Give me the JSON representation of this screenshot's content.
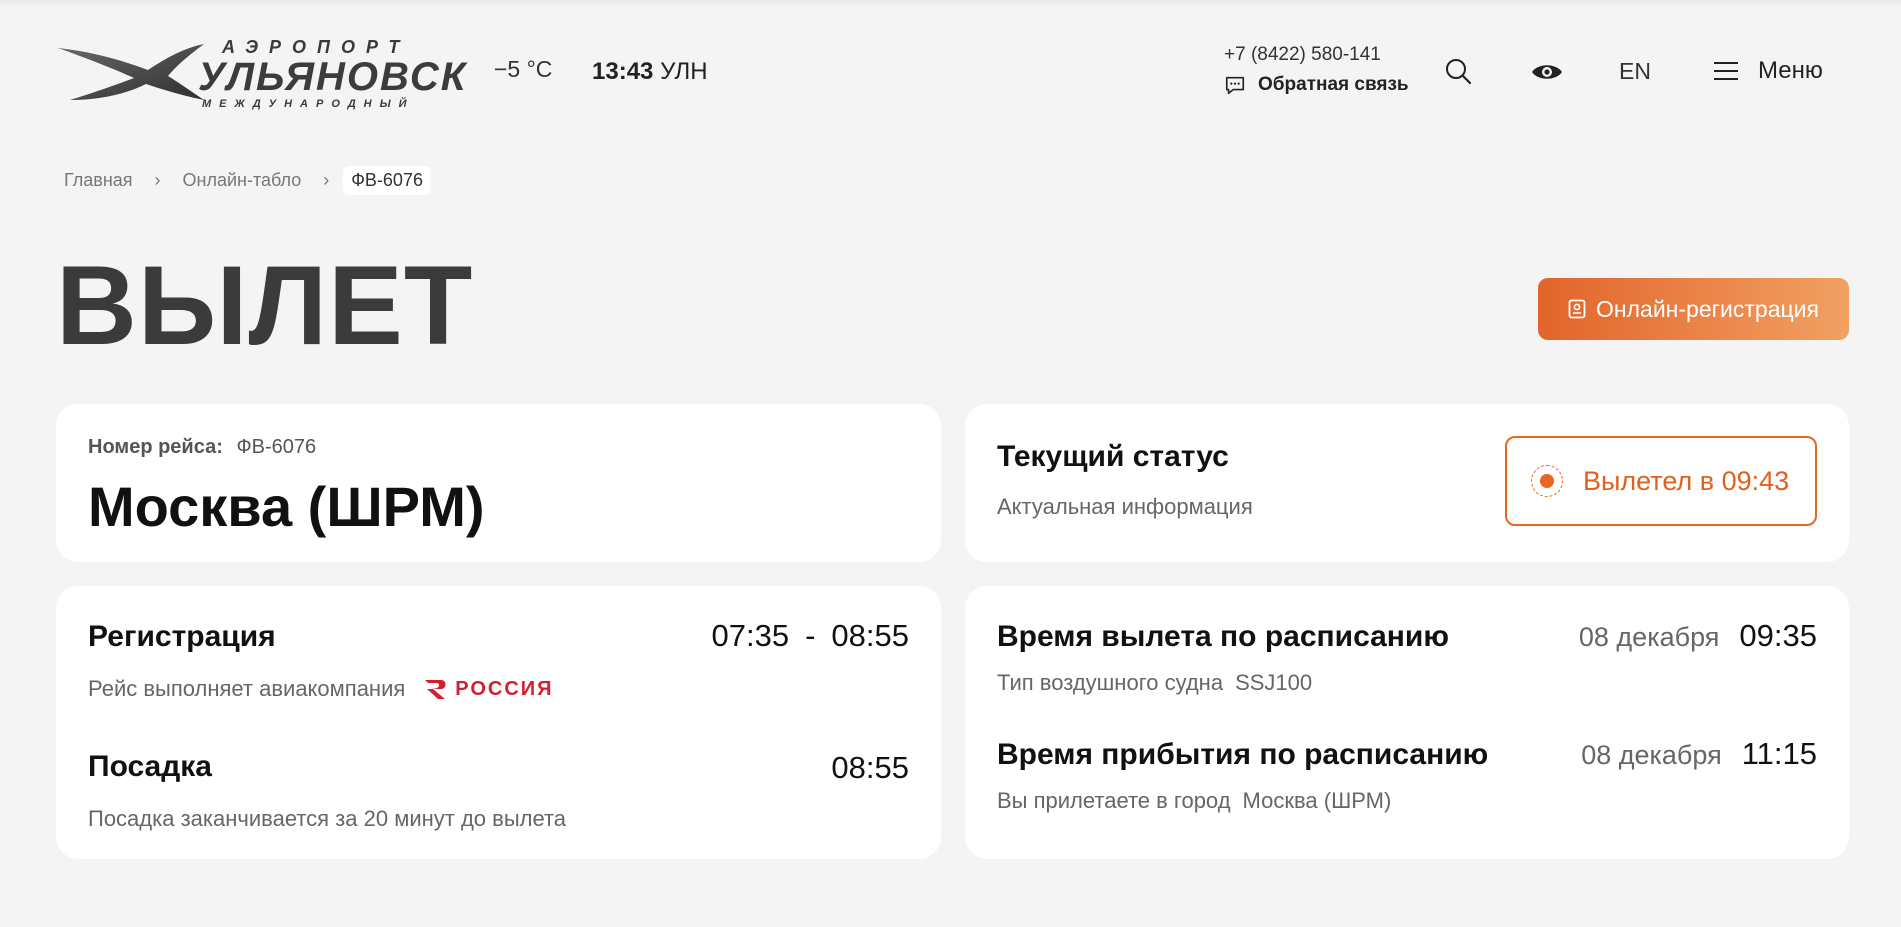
{
  "header": {
    "logo": {
      "line1": "АЭРОПОРТ",
      "line2": "УЛЬЯНОВСК",
      "line3": "МЕЖДУНАРОДНЫЙ"
    },
    "weather": "−5 °C",
    "time": "13:43",
    "timezone": "УЛН",
    "phone": "+7 (8422) 580-141",
    "feedback_label": "Обратная связь",
    "lang": "EN",
    "menu_label": "Меню",
    "icons": [
      "search-icon",
      "eye-icon",
      "menu-icon",
      "chat-icon"
    ]
  },
  "breadcrumb": {
    "items": [
      "Главная",
      "Онлайн-табло"
    ],
    "current": "ФВ-6076"
  },
  "page_title": "ВЫЛЕТ",
  "checkin_button": "Онлайн-регистрация",
  "flight": {
    "number_label": "Номер рейса:",
    "number": "ФВ-6076",
    "destination": "Москва (ШРМ)"
  },
  "status": {
    "title": "Текущий статус",
    "subtitle": "Актуальная информация",
    "badge": "Вылетел в 09:43",
    "accent_color": "#e8661f"
  },
  "registration": {
    "title": "Регистрация",
    "start": "07:35",
    "separator": "-",
    "end": "08:55",
    "airline_text": "Рейс выполняет авиакомпания",
    "airline_name": "РОССИЯ"
  },
  "boarding": {
    "title": "Посадка",
    "time": "08:55",
    "note": "Посадка заканчивается за 20 минут до вылета"
  },
  "departure": {
    "title": "Время вылета по расписанию",
    "date": "08 декабря",
    "time": "09:35",
    "aircraft_label": "Тип воздушного судна",
    "aircraft": "SSJ100"
  },
  "arrival": {
    "title": "Время прибытия по расписанию",
    "date": "08 декабря",
    "time": "11:15",
    "city_label": "Вы прилетаете в город",
    "city": "Москва (ШРМ)"
  }
}
